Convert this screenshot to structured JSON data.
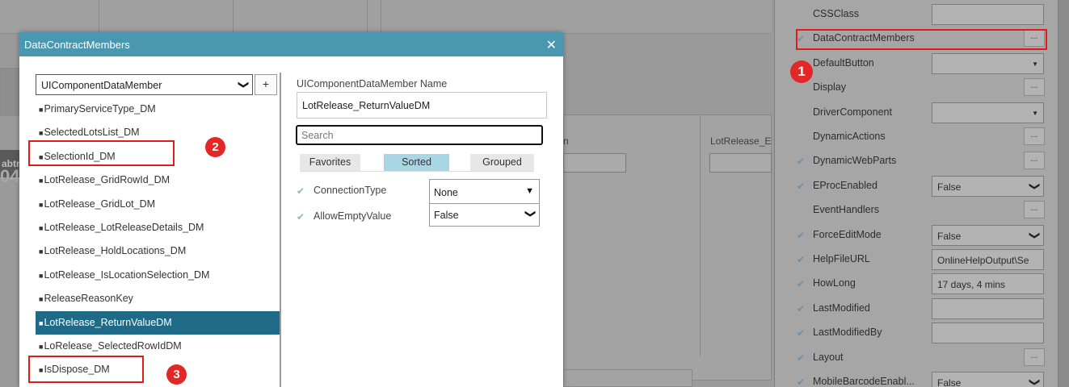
{
  "background": {
    "field_label": "LotRelease_E",
    "field_label_partial": "n",
    "left_strip_text_1": "abtn",
    "left_strip_text_2": "04"
  },
  "properties_panel": {
    "rows": [
      {
        "name": "CSSClass",
        "value": "",
        "kind": "input",
        "checked": false
      },
      {
        "name": "DataContractMembers",
        "value": "...",
        "kind": "ellipsis",
        "checked": true
      },
      {
        "name": "DefaultButton",
        "value": "",
        "kind": "select",
        "checked": false
      },
      {
        "name": "Display",
        "value": "...",
        "kind": "ellipsis",
        "checked": false
      },
      {
        "name": "DriverComponent",
        "value": "",
        "kind": "select",
        "checked": false
      },
      {
        "name": "DynamicActions",
        "value": "...",
        "kind": "ellipsis",
        "checked": false
      },
      {
        "name": "DynamicWebParts",
        "value": "...",
        "kind": "ellipsis",
        "checked": true
      },
      {
        "name": "EProcEnabled",
        "value": "False",
        "kind": "dropdown",
        "checked": true
      },
      {
        "name": "EventHandlers",
        "value": "...",
        "kind": "ellipsis",
        "checked": false
      },
      {
        "name": "ForceEditMode",
        "value": "False",
        "kind": "dropdown",
        "checked": true
      },
      {
        "name": "HelpFileURL",
        "value": "OnlineHelpOutput\\Se",
        "kind": "input",
        "checked": true
      },
      {
        "name": "HowLong",
        "value": "17 days, 4 mins",
        "kind": "input",
        "checked": true
      },
      {
        "name": "LastModified",
        "value": "",
        "kind": "input",
        "checked": true
      },
      {
        "name": "LastModifiedBy",
        "value": "",
        "kind": "input",
        "checked": true
      },
      {
        "name": "Layout",
        "value": "...",
        "kind": "ellipsis",
        "checked": true
      },
      {
        "name": "MobileBarcodeEnabl...",
        "value": "False",
        "kind": "dropdown",
        "checked": true
      }
    ]
  },
  "annotations": {
    "badge_1": "1",
    "badge_2": "2",
    "badge_3": "3"
  },
  "dialog": {
    "title": "DataContractMembers",
    "close_glyph": "✕",
    "type_select": "UIComponentDataMember",
    "add_button": "+",
    "members": [
      "PrimaryServiceType_DM",
      "SelectedLotsList_DM",
      "SelectionId_DM",
      "LotRelease_GridRowId_DM",
      "LotRelease_GridLot_DM",
      "LotRelease_LotReleaseDetails_DM",
      "LotRelease_HoldLocations_DM",
      "LotRelease_IsLocationSelection_DM",
      "ReleaseReasonKey",
      "LotRelease_ReturnValueDM",
      "LoRelease_SelectedRowIdDM",
      "IsDispose_DM"
    ],
    "selected_index": 9,
    "name_label": "UIComponentDataMember Name",
    "name_value": "LotRelease_ReturnValueDM",
    "search_placeholder": "Search",
    "tabs": [
      "Favorites",
      "Sorted",
      "Grouped"
    ],
    "active_tab": "Sorted",
    "properties": [
      {
        "name": "ConnectionType",
        "value": "None"
      },
      {
        "name": "AllowEmptyValue",
        "value": "False"
      }
    ]
  },
  "colors": {
    "dialog_title_bar": "#4a97b0",
    "selected_item": "#1f6b87",
    "active_tab": "#a8d6e4",
    "annotation_red": "#e01b1b"
  }
}
